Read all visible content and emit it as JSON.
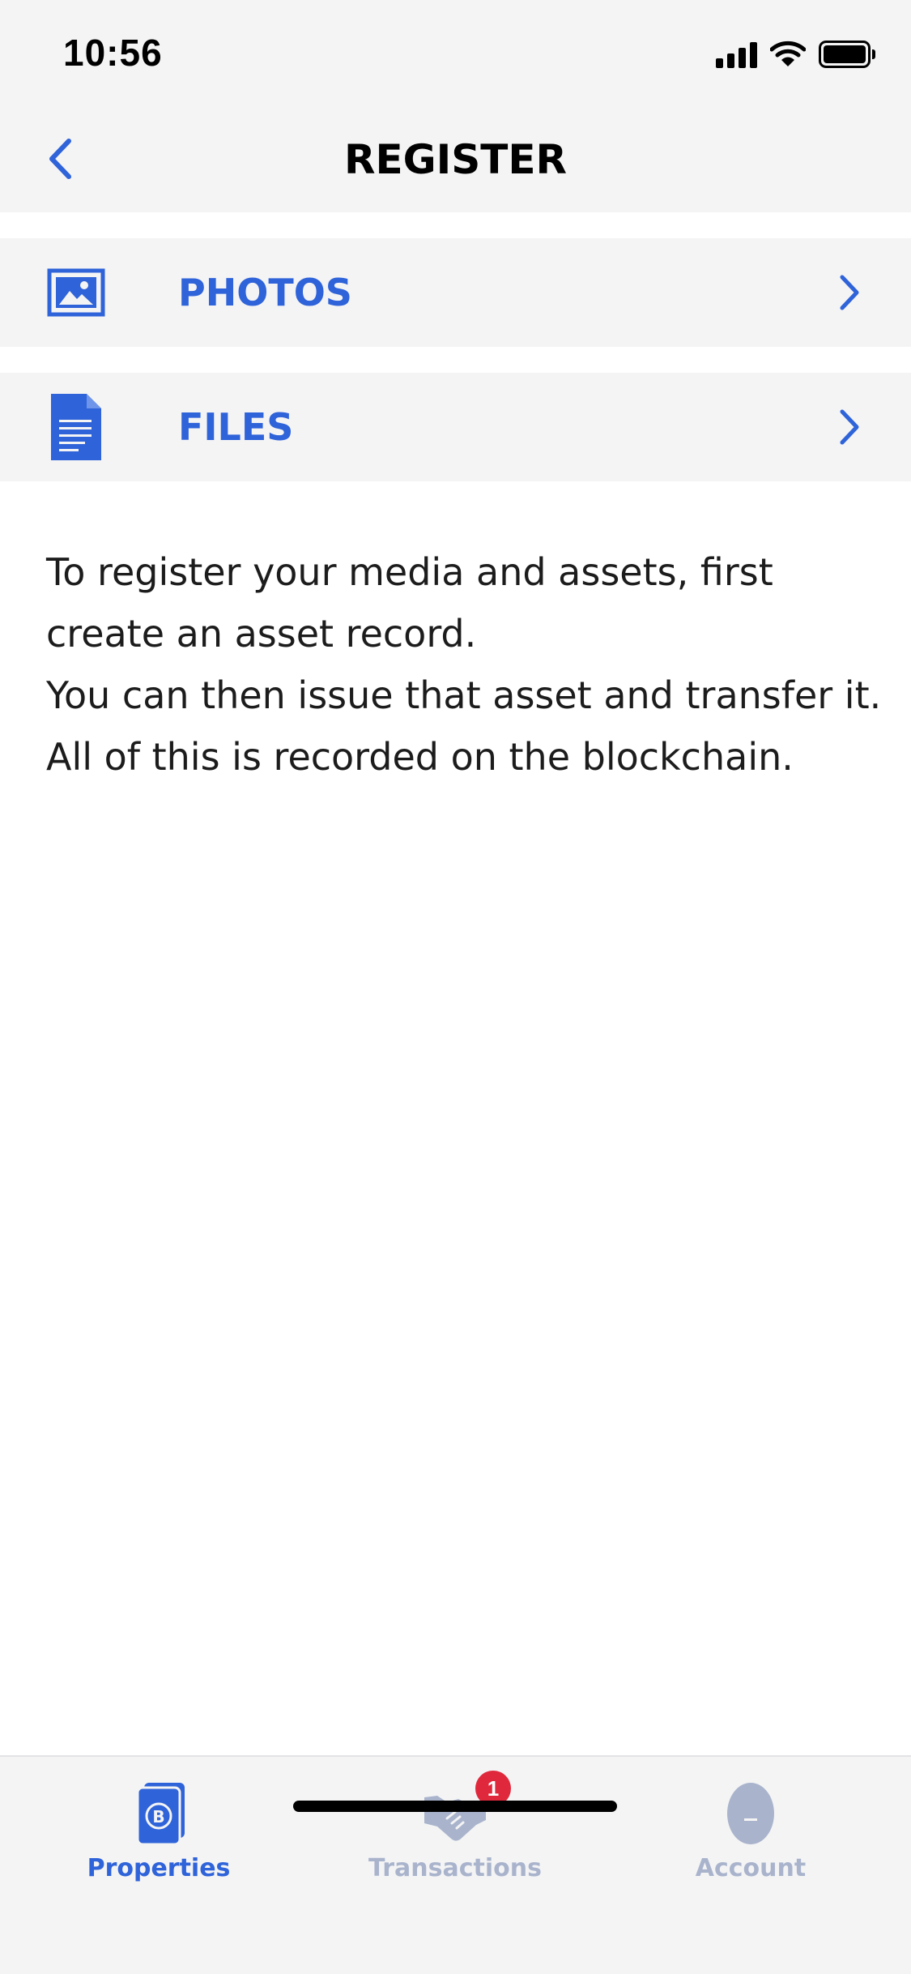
{
  "status_bar": {
    "time": "10:56"
  },
  "nav": {
    "title": "REGISTER",
    "back_icon": "chevron-left-icon"
  },
  "menu": [
    {
      "label": "PHOTOS",
      "icon": "image-icon"
    },
    {
      "label": "FILES",
      "icon": "document-icon"
    }
  ],
  "description": {
    "lines": [
      "To register your media and assets, first",
      "create an asset record.",
      "You can then issue that asset and transfer it.",
      "All of this is recorded on the blockchain."
    ]
  },
  "tabs": [
    {
      "label": "Properties",
      "icon": "properties-icon",
      "active": true
    },
    {
      "label": "Transactions",
      "icon": "handshake-icon",
      "active": false,
      "badge": "1"
    },
    {
      "label": "Account",
      "icon": "account-icon",
      "active": false
    }
  ],
  "colors": {
    "accent": "#2f63d9",
    "inactive": "#a9b4cc",
    "badge": "#e0283c",
    "bar_background": "#f4f4f5"
  }
}
